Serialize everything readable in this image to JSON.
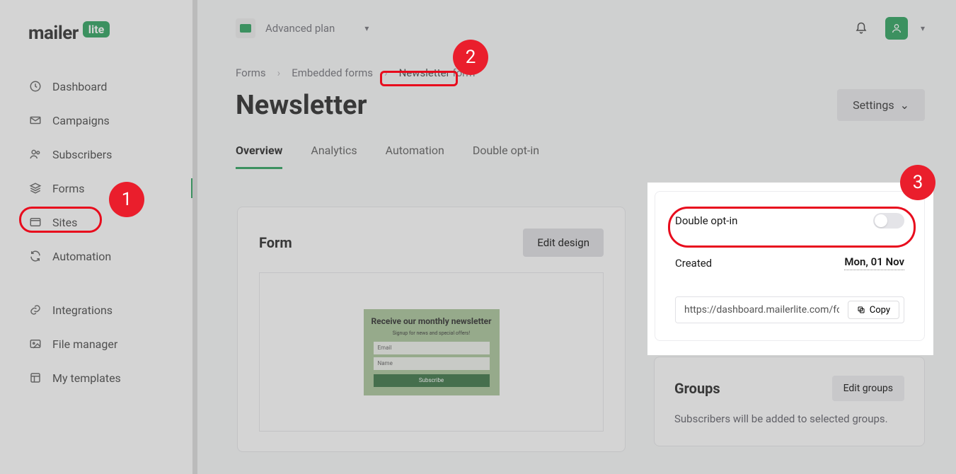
{
  "logo": {
    "main": "mailer",
    "badge": "lite"
  },
  "sidebar": {
    "items": [
      {
        "label": "Dashboard"
      },
      {
        "label": "Campaigns"
      },
      {
        "label": "Subscribers"
      },
      {
        "label": "Forms"
      },
      {
        "label": "Sites"
      },
      {
        "label": "Automation"
      },
      {
        "label": "Integrations"
      },
      {
        "label": "File manager"
      },
      {
        "label": "My templates"
      }
    ]
  },
  "topbar": {
    "plan": "Advanced plan"
  },
  "breadcrumb": {
    "a": "Forms",
    "b": "Embedded forms",
    "c1": "Newsletter",
    "c2": " form"
  },
  "page": {
    "title": "Newsletter",
    "settings": "Settings"
  },
  "tabs": [
    "Overview",
    "Analytics",
    "Automation",
    "Double opt-in"
  ],
  "formcard": {
    "title": "Form",
    "edit": "Edit design",
    "preview": {
      "heading": "Receive our monthly newsletter",
      "sub": "Signup for news and special offers!",
      "ph1": "Email",
      "ph2": "Name",
      "btn": "Subscribe"
    }
  },
  "info": {
    "optin_label": "Double opt-in",
    "created_label": "Created",
    "created_value": "Mon, 01 Nov",
    "url": "https://dashboard.mailerlite.com/fo",
    "copy": "Copy"
  },
  "groups": {
    "title": "Groups",
    "edit": "Edit groups",
    "desc": "Subscribers will be added to selected groups."
  },
  "annot": {
    "n1": "1",
    "n2": "2",
    "n3": "3"
  }
}
